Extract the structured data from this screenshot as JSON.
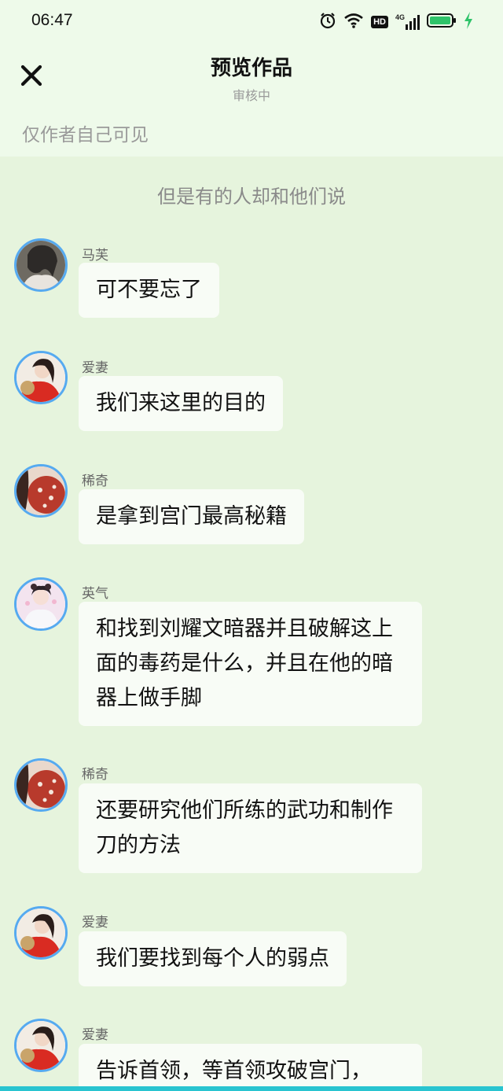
{
  "status_bar": {
    "time": "06:47",
    "hd_label": "HD",
    "network_label": "4G"
  },
  "header": {
    "title": "预览作品",
    "subtitle": "审核中",
    "visibility": "仅作者自己可见"
  },
  "narration": "但是有的人却和他们说",
  "messages": [
    {
      "name": "马芙",
      "text": "可不要忘了",
      "avatar": "avatar-mafu"
    },
    {
      "name": "爱妻",
      "text": "我们来这里的目的",
      "avatar": "avatar-aiqi"
    },
    {
      "name": "稀奇",
      "text": "是拿到宫门最高秘籍",
      "avatar": "avatar-xiqi"
    },
    {
      "name": "英气",
      "text": "和找到刘耀文暗器并且破解这上面的毒药是什么，并且在他的暗器上做手脚",
      "avatar": "avatar-yingqi"
    },
    {
      "name": "稀奇",
      "text": "还要研究他们所练的武功和制作刀的方法",
      "avatar": "avatar-xiqi"
    },
    {
      "name": "爱妻",
      "text": "我们要找到每个人的弱点",
      "avatar": "avatar-aiqi"
    },
    {
      "name": "爱妻",
      "text": "告诉首领，等首领攻破宫门，",
      "avatar": "avatar-aiqi"
    }
  ],
  "colors": {
    "background": "#e6f4dd",
    "header_background": "#eefaea",
    "bubble": "#f8fcf6",
    "avatar_ring": "#56aaf0",
    "battery": "#2fc36a"
  },
  "icons": [
    "alarm-icon",
    "wifi-icon",
    "signal-icon",
    "battery-icon",
    "charging-icon",
    "close-icon"
  ]
}
